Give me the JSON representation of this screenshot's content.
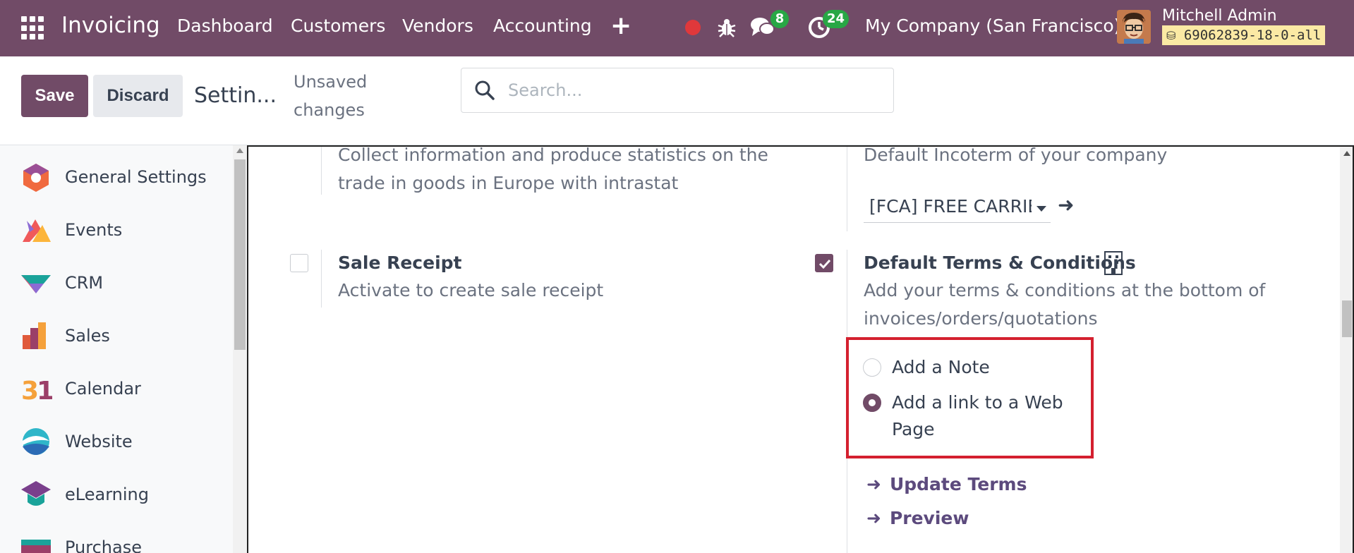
{
  "navbar": {
    "app_name": "Invoicing",
    "menu": [
      "Dashboard",
      "Customers",
      "Vendors",
      "Accounting"
    ],
    "chat_count": "8",
    "activity_count": "24",
    "company": "My Company (San Francisco)",
    "user_name": "Mitchell Admin",
    "database": "69062839-18-0-all"
  },
  "control_panel": {
    "save_label": "Save",
    "discard_label": "Discard",
    "breadcrumb": "Settin...",
    "unsaved_label": "Unsaved changes",
    "search_placeholder": "Search..."
  },
  "sidebar": {
    "items": [
      {
        "label": "General Settings",
        "icon": "general-settings-icon"
      },
      {
        "label": "Events",
        "icon": "events-icon"
      },
      {
        "label": "CRM",
        "icon": "crm-icon"
      },
      {
        "label": "Sales",
        "icon": "sales-icon"
      },
      {
        "label": "Calendar",
        "icon": "calendar-icon"
      },
      {
        "label": "Website",
        "icon": "website-icon"
      },
      {
        "label": "eLearning",
        "icon": "elearning-icon"
      },
      {
        "label": "Purchase",
        "icon": "purchase-icon"
      }
    ]
  },
  "settings": {
    "intrastat": {
      "description": "Collect information and produce statistics on the trade in goods in Europe with intrastat"
    },
    "incoterm": {
      "description": "Default Incoterm of your company",
      "value": "[FCA] FREE CARRIER"
    },
    "sale_receipt": {
      "title": "Sale Receipt",
      "description": "Activate to create sale receipt",
      "checked": false
    },
    "terms": {
      "title": "Default Terms & Conditions",
      "description": "Add your terms & conditions at the bottom of invoices/orders/quotations",
      "checked": true,
      "options": [
        "Add a Note",
        "Add a link to a Web Page"
      ],
      "selected": "Add a link to a Web Page",
      "update_link": "Update Terms",
      "preview_link": "Preview"
    }
  },
  "colors": {
    "brand": "#714b67",
    "highlight_border": "#d4202f",
    "badge": "#28a745"
  }
}
